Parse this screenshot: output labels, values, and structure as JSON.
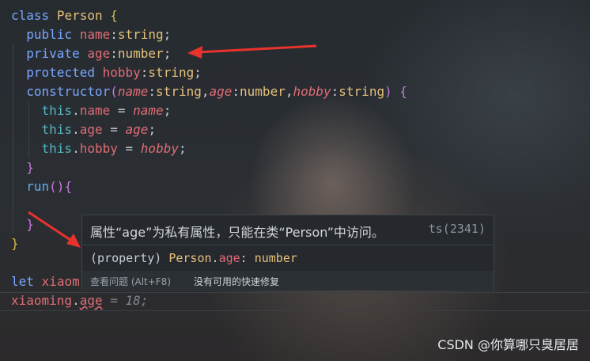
{
  "code": {
    "l1": [
      "class",
      "Person",
      "{"
    ],
    "l2": [
      "public",
      "name",
      ":",
      "string",
      ";"
    ],
    "l3": [
      "private",
      "age",
      ":",
      "number",
      ";"
    ],
    "l4": [
      "protected",
      "hobby",
      ":",
      "string",
      ";"
    ],
    "l5": [
      "constructor",
      "(",
      "name",
      ":",
      "string",
      ",",
      "age",
      ":",
      "number",
      ",",
      "hobby",
      ":",
      "string",
      ")",
      "{"
    ],
    "l6": [
      "this",
      ".",
      "name",
      "=",
      "name",
      ";"
    ],
    "l7": [
      "this",
      ".",
      "age",
      "=",
      "age",
      ";"
    ],
    "l8": [
      "this",
      ".",
      "hobby",
      "=",
      "hobby",
      ";"
    ],
    "l9": "}",
    "l10": [
      "run",
      "(){"
    ],
    "l12": "}",
    "l13": "}",
    "l15": [
      "let",
      "xiaom"
    ],
    "l16": [
      "xiaoming",
      ".",
      "age",
      "= 18;"
    ]
  },
  "hover": {
    "message": "属性“age”为私有属性，只能在类“Person”中访问。",
    "code": "ts(2341)",
    "sig_kind": "(property)",
    "sig_owner": "Person",
    "sig_prop": "age",
    "sig_sep": ": ",
    "sig_type": "number",
    "action_view": "查看问题 (Alt+F8)",
    "action_fix": "没有可用的快速修复"
  },
  "watermark": "CSDN @你算哪只臭居居",
  "colors": {
    "arrow": "#e8322c",
    "keyword": "#56b6c2",
    "property": "#e06c75",
    "type": "#e5c07b"
  }
}
